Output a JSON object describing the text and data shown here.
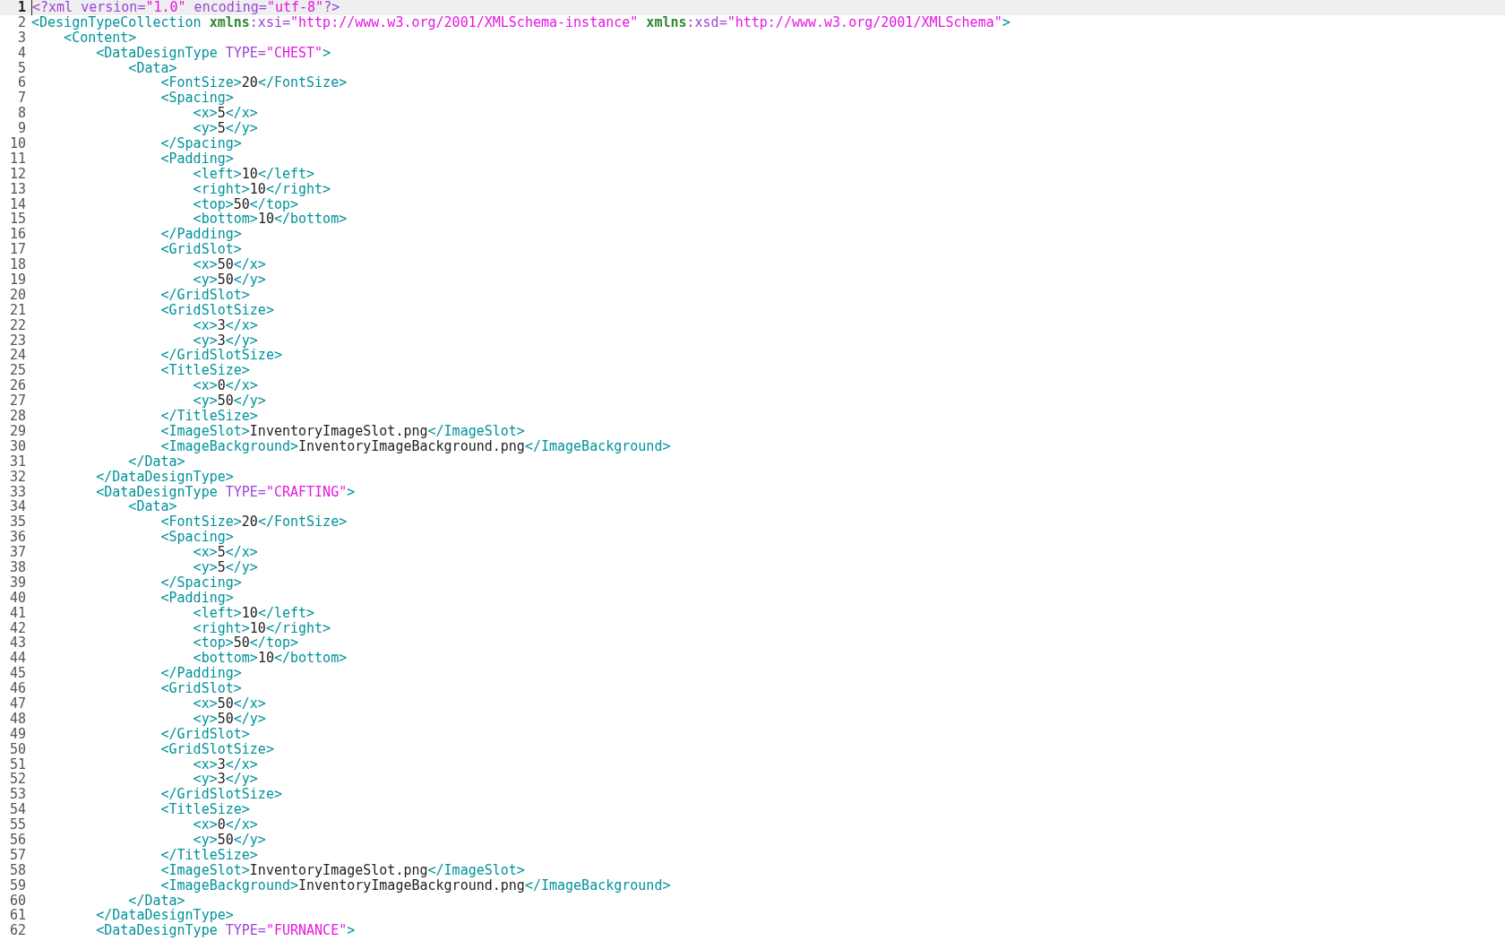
{
  "editor": {
    "lines": [
      {
        "number": "1",
        "current": true,
        "tokens": [
          {
            "kind": "pi",
            "text": "<?xml version="
          },
          {
            "kind": "value",
            "text": "\"1.0\""
          },
          {
            "kind": "pi",
            "text": " encoding="
          },
          {
            "kind": "value",
            "text": "\"utf-8\""
          },
          {
            "kind": "pi",
            "text": "?>"
          }
        ]
      },
      {
        "number": "2",
        "current": false,
        "tokens": [
          {
            "kind": "tag",
            "text": "<DesignTypeCollection "
          },
          {
            "kind": "ns",
            "text": "xmlns"
          },
          {
            "kind": "attr",
            "text": ":xsi="
          },
          {
            "kind": "value",
            "text": "\"http://www.w3.org/2001/XMLSchema-instance\" "
          },
          {
            "kind": "ns",
            "text": "xmlns"
          },
          {
            "kind": "attr",
            "text": ":xsd="
          },
          {
            "kind": "value",
            "text": "\"http://www.w3.org/2001/XMLSchema\""
          },
          {
            "kind": "tag",
            "text": ">"
          }
        ]
      },
      {
        "number": "3",
        "current": false,
        "tokens": [
          {
            "kind": "tag",
            "text": "    <Content>"
          }
        ]
      },
      {
        "number": "4",
        "current": false,
        "tokens": [
          {
            "kind": "tag",
            "text": "        <DataDesignType "
          },
          {
            "kind": "attr",
            "text": "TYPE="
          },
          {
            "kind": "value",
            "text": "\"CHEST\""
          },
          {
            "kind": "tag",
            "text": ">"
          }
        ]
      },
      {
        "number": "5",
        "current": false,
        "tokens": [
          {
            "kind": "tag",
            "text": "            <Data>"
          }
        ]
      },
      {
        "number": "6",
        "current": false,
        "tokens": [
          {
            "kind": "tag",
            "text": "                <FontSize>"
          },
          {
            "kind": "text",
            "text": "20"
          },
          {
            "kind": "tag",
            "text": "</FontSize>"
          }
        ]
      },
      {
        "number": "7",
        "current": false,
        "tokens": [
          {
            "kind": "tag",
            "text": "                <Spacing>"
          }
        ]
      },
      {
        "number": "8",
        "current": false,
        "tokens": [
          {
            "kind": "tag",
            "text": "                    <x>"
          },
          {
            "kind": "text",
            "text": "5"
          },
          {
            "kind": "tag",
            "text": "</x>"
          }
        ]
      },
      {
        "number": "9",
        "current": false,
        "tokens": [
          {
            "kind": "tag",
            "text": "                    <y>"
          },
          {
            "kind": "text",
            "text": "5"
          },
          {
            "kind": "tag",
            "text": "</y>"
          }
        ]
      },
      {
        "number": "10",
        "current": false,
        "tokens": [
          {
            "kind": "tag",
            "text": "                </Spacing>"
          }
        ]
      },
      {
        "number": "11",
        "current": false,
        "tokens": [
          {
            "kind": "tag",
            "text": "                <Padding>"
          }
        ]
      },
      {
        "number": "12",
        "current": false,
        "tokens": [
          {
            "kind": "tag",
            "text": "                    <left>"
          },
          {
            "kind": "text",
            "text": "10"
          },
          {
            "kind": "tag",
            "text": "</left>"
          }
        ]
      },
      {
        "number": "13",
        "current": false,
        "tokens": [
          {
            "kind": "tag",
            "text": "                    <right>"
          },
          {
            "kind": "text",
            "text": "10"
          },
          {
            "kind": "tag",
            "text": "</right>"
          }
        ]
      },
      {
        "number": "14",
        "current": false,
        "tokens": [
          {
            "kind": "tag",
            "text": "                    <top>"
          },
          {
            "kind": "text",
            "text": "50"
          },
          {
            "kind": "tag",
            "text": "</top>"
          }
        ]
      },
      {
        "number": "15",
        "current": false,
        "tokens": [
          {
            "kind": "tag",
            "text": "                    <bottom>"
          },
          {
            "kind": "text",
            "text": "10"
          },
          {
            "kind": "tag",
            "text": "</bottom>"
          }
        ]
      },
      {
        "number": "16",
        "current": false,
        "tokens": [
          {
            "kind": "tag",
            "text": "                </Padding>"
          }
        ]
      },
      {
        "number": "17",
        "current": false,
        "tokens": [
          {
            "kind": "tag",
            "text": "                <GridSlot>"
          }
        ]
      },
      {
        "number": "18",
        "current": false,
        "tokens": [
          {
            "kind": "tag",
            "text": "                    <x>"
          },
          {
            "kind": "text",
            "text": "50"
          },
          {
            "kind": "tag",
            "text": "</x>"
          }
        ]
      },
      {
        "number": "19",
        "current": false,
        "tokens": [
          {
            "kind": "tag",
            "text": "                    <y>"
          },
          {
            "kind": "text",
            "text": "50"
          },
          {
            "kind": "tag",
            "text": "</y>"
          }
        ]
      },
      {
        "number": "20",
        "current": false,
        "tokens": [
          {
            "kind": "tag",
            "text": "                </GridSlot>"
          }
        ]
      },
      {
        "number": "21",
        "current": false,
        "tokens": [
          {
            "kind": "tag",
            "text": "                <GridSlotSize>"
          }
        ]
      },
      {
        "number": "22",
        "current": false,
        "tokens": [
          {
            "kind": "tag",
            "text": "                    <x>"
          },
          {
            "kind": "text",
            "text": "3"
          },
          {
            "kind": "tag",
            "text": "</x>"
          }
        ]
      },
      {
        "number": "23",
        "current": false,
        "tokens": [
          {
            "kind": "tag",
            "text": "                    <y>"
          },
          {
            "kind": "text",
            "text": "3"
          },
          {
            "kind": "tag",
            "text": "</y>"
          }
        ]
      },
      {
        "number": "24",
        "current": false,
        "tokens": [
          {
            "kind": "tag",
            "text": "                </GridSlotSize>"
          }
        ]
      },
      {
        "number": "25",
        "current": false,
        "tokens": [
          {
            "kind": "tag",
            "text": "                <TitleSize>"
          }
        ]
      },
      {
        "number": "26",
        "current": false,
        "tokens": [
          {
            "kind": "tag",
            "text": "                    <x>"
          },
          {
            "kind": "text",
            "text": "0"
          },
          {
            "kind": "tag",
            "text": "</x>"
          }
        ]
      },
      {
        "number": "27",
        "current": false,
        "tokens": [
          {
            "kind": "tag",
            "text": "                    <y>"
          },
          {
            "kind": "text",
            "text": "50"
          },
          {
            "kind": "tag",
            "text": "</y>"
          }
        ]
      },
      {
        "number": "28",
        "current": false,
        "tokens": [
          {
            "kind": "tag",
            "text": "                </TitleSize>"
          }
        ]
      },
      {
        "number": "29",
        "current": false,
        "tokens": [
          {
            "kind": "tag",
            "text": "                <ImageSlot>"
          },
          {
            "kind": "text",
            "text": "InventoryImageSlot.png"
          },
          {
            "kind": "tag",
            "text": "</ImageSlot>"
          }
        ]
      },
      {
        "number": "30",
        "current": false,
        "tokens": [
          {
            "kind": "tag",
            "text": "                <ImageBackground>"
          },
          {
            "kind": "text",
            "text": "InventoryImageBackground.png"
          },
          {
            "kind": "tag",
            "text": "</ImageBackground>"
          }
        ]
      },
      {
        "number": "31",
        "current": false,
        "tokens": [
          {
            "kind": "tag",
            "text": "            </Data>"
          }
        ]
      },
      {
        "number": "32",
        "current": false,
        "tokens": [
          {
            "kind": "tag",
            "text": "        </DataDesignType>"
          }
        ]
      },
      {
        "number": "33",
        "current": false,
        "tokens": [
          {
            "kind": "tag",
            "text": "        <DataDesignType "
          },
          {
            "kind": "attr",
            "text": "TYPE="
          },
          {
            "kind": "value",
            "text": "\"CRAFTING\""
          },
          {
            "kind": "tag",
            "text": ">"
          }
        ]
      },
      {
        "number": "34",
        "current": false,
        "tokens": [
          {
            "kind": "tag",
            "text": "            <Data>"
          }
        ]
      },
      {
        "number": "35",
        "current": false,
        "tokens": [
          {
            "kind": "tag",
            "text": "                <FontSize>"
          },
          {
            "kind": "text",
            "text": "20"
          },
          {
            "kind": "tag",
            "text": "</FontSize>"
          }
        ]
      },
      {
        "number": "36",
        "current": false,
        "tokens": [
          {
            "kind": "tag",
            "text": "                <Spacing>"
          }
        ]
      },
      {
        "number": "37",
        "current": false,
        "tokens": [
          {
            "kind": "tag",
            "text": "                    <x>"
          },
          {
            "kind": "text",
            "text": "5"
          },
          {
            "kind": "tag",
            "text": "</x>"
          }
        ]
      },
      {
        "number": "38",
        "current": false,
        "tokens": [
          {
            "kind": "tag",
            "text": "                    <y>"
          },
          {
            "kind": "text",
            "text": "5"
          },
          {
            "kind": "tag",
            "text": "</y>"
          }
        ]
      },
      {
        "number": "39",
        "current": false,
        "tokens": [
          {
            "kind": "tag",
            "text": "                </Spacing>"
          }
        ]
      },
      {
        "number": "40",
        "current": false,
        "tokens": [
          {
            "kind": "tag",
            "text": "                <Padding>"
          }
        ]
      },
      {
        "number": "41",
        "current": false,
        "tokens": [
          {
            "kind": "tag",
            "text": "                    <left>"
          },
          {
            "kind": "text",
            "text": "10"
          },
          {
            "kind": "tag",
            "text": "</left>"
          }
        ]
      },
      {
        "number": "42",
        "current": false,
        "tokens": [
          {
            "kind": "tag",
            "text": "                    <right>"
          },
          {
            "kind": "text",
            "text": "10"
          },
          {
            "kind": "tag",
            "text": "</right>"
          }
        ]
      },
      {
        "number": "43",
        "current": false,
        "tokens": [
          {
            "kind": "tag",
            "text": "                    <top>"
          },
          {
            "kind": "text",
            "text": "50"
          },
          {
            "kind": "tag",
            "text": "</top>"
          }
        ]
      },
      {
        "number": "44",
        "current": false,
        "tokens": [
          {
            "kind": "tag",
            "text": "                    <bottom>"
          },
          {
            "kind": "text",
            "text": "10"
          },
          {
            "kind": "tag",
            "text": "</bottom>"
          }
        ]
      },
      {
        "number": "45",
        "current": false,
        "tokens": [
          {
            "kind": "tag",
            "text": "                </Padding>"
          }
        ]
      },
      {
        "number": "46",
        "current": false,
        "tokens": [
          {
            "kind": "tag",
            "text": "                <GridSlot>"
          }
        ]
      },
      {
        "number": "47",
        "current": false,
        "tokens": [
          {
            "kind": "tag",
            "text": "                    <x>"
          },
          {
            "kind": "text",
            "text": "50"
          },
          {
            "kind": "tag",
            "text": "</x>"
          }
        ]
      },
      {
        "number": "48",
        "current": false,
        "tokens": [
          {
            "kind": "tag",
            "text": "                    <y>"
          },
          {
            "kind": "text",
            "text": "50"
          },
          {
            "kind": "tag",
            "text": "</y>"
          }
        ]
      },
      {
        "number": "49",
        "current": false,
        "tokens": [
          {
            "kind": "tag",
            "text": "                </GridSlot>"
          }
        ]
      },
      {
        "number": "50",
        "current": false,
        "tokens": [
          {
            "kind": "tag",
            "text": "                <GridSlotSize>"
          }
        ]
      },
      {
        "number": "51",
        "current": false,
        "tokens": [
          {
            "kind": "tag",
            "text": "                    <x>"
          },
          {
            "kind": "text",
            "text": "3"
          },
          {
            "kind": "tag",
            "text": "</x>"
          }
        ]
      },
      {
        "number": "52",
        "current": false,
        "tokens": [
          {
            "kind": "tag",
            "text": "                    <y>"
          },
          {
            "kind": "text",
            "text": "3"
          },
          {
            "kind": "tag",
            "text": "</y>"
          }
        ]
      },
      {
        "number": "53",
        "current": false,
        "tokens": [
          {
            "kind": "tag",
            "text": "                </GridSlotSize>"
          }
        ]
      },
      {
        "number": "54",
        "current": false,
        "tokens": [
          {
            "kind": "tag",
            "text": "                <TitleSize>"
          }
        ]
      },
      {
        "number": "55",
        "current": false,
        "tokens": [
          {
            "kind": "tag",
            "text": "                    <x>"
          },
          {
            "kind": "text",
            "text": "0"
          },
          {
            "kind": "tag",
            "text": "</x>"
          }
        ]
      },
      {
        "number": "56",
        "current": false,
        "tokens": [
          {
            "kind": "tag",
            "text": "                    <y>"
          },
          {
            "kind": "text",
            "text": "50"
          },
          {
            "kind": "tag",
            "text": "</y>"
          }
        ]
      },
      {
        "number": "57",
        "current": false,
        "tokens": [
          {
            "kind": "tag",
            "text": "                </TitleSize>"
          }
        ]
      },
      {
        "number": "58",
        "current": false,
        "tokens": [
          {
            "kind": "tag",
            "text": "                <ImageSlot>"
          },
          {
            "kind": "text",
            "text": "InventoryImageSlot.png"
          },
          {
            "kind": "tag",
            "text": "</ImageSlot>"
          }
        ]
      },
      {
        "number": "59",
        "current": false,
        "tokens": [
          {
            "kind": "tag",
            "text": "                <ImageBackground>"
          },
          {
            "kind": "text",
            "text": "InventoryImageBackground.png"
          },
          {
            "kind": "tag",
            "text": "</ImageBackground>"
          }
        ]
      },
      {
        "number": "60",
        "current": false,
        "tokens": [
          {
            "kind": "tag",
            "text": "            </Data>"
          }
        ]
      },
      {
        "number": "61",
        "current": false,
        "tokens": [
          {
            "kind": "tag",
            "text": "        </DataDesignType>"
          }
        ]
      },
      {
        "number": "62",
        "current": false,
        "tokens": [
          {
            "kind": "tag",
            "text": "        <DataDesignType "
          },
          {
            "kind": "attr",
            "text": "TYPE="
          },
          {
            "kind": "value",
            "text": "\"FURNANCE\""
          },
          {
            "kind": "tag",
            "text": ">"
          }
        ]
      }
    ]
  }
}
